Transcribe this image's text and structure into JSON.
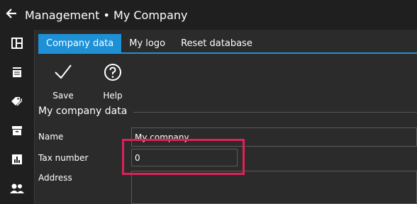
{
  "header": {
    "title": "Management • My Company"
  },
  "tabs": [
    {
      "label": "Company data"
    },
    {
      "label": "My logo"
    },
    {
      "label": "Reset database"
    }
  ],
  "toolbar": {
    "save_label": "Save",
    "help_label": "Help"
  },
  "section": {
    "title": "My company data"
  },
  "fields": {
    "name": {
      "label": "Name",
      "value": "My company"
    },
    "tax": {
      "label": "Tax number",
      "value": "0"
    },
    "address": {
      "label": "Address",
      "value": ""
    }
  },
  "colors": {
    "accent": "#1e90d6",
    "highlight": "#e0205a",
    "background": "#2b2b2b"
  },
  "icons": {
    "back": "arrow-left-icon",
    "sidebar": [
      "layout-icon",
      "list-icon",
      "tag-icon",
      "archive-icon",
      "bar-chart-icon",
      "users-icon"
    ],
    "save": "checkmark-icon",
    "help": "question-icon"
  }
}
